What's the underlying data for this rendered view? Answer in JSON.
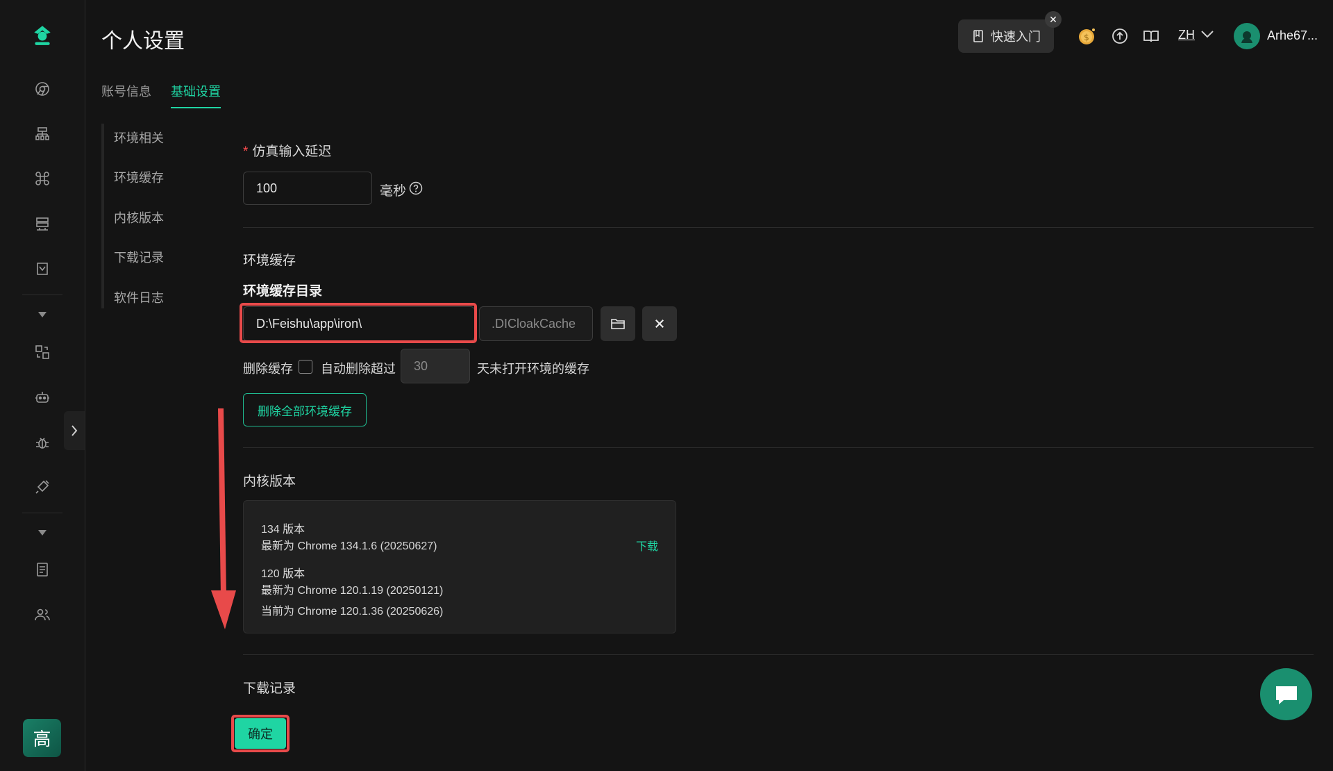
{
  "page": {
    "title": "个人设置"
  },
  "tabs": [
    {
      "label": "账号信息"
    },
    {
      "label": "基础设置"
    }
  ],
  "subnav": [
    "环境相关",
    "环境缓存",
    "内核版本",
    "下载记录",
    "软件日志"
  ],
  "topbar": {
    "quick_start": "快速入门",
    "lang": "ZH",
    "username": "Arhe67..."
  },
  "input_delay": {
    "label": "仿真输入延迟",
    "value": "100",
    "unit": "毫秒"
  },
  "cache": {
    "section_title": "环境缓存",
    "dir_label": "环境缓存目录",
    "dir_value": "D:\\Feishu\\app\\iron\\",
    "suffix": ".DICloakCache",
    "delete_label": "删除缓存",
    "auto_delete_label": "自动删除超过",
    "days_value": "30",
    "days_suffix": "天未打开环境的缓存",
    "delete_all_button": "删除全部环境缓存"
  },
  "kernel": {
    "section_title": "内核版本",
    "v134_title": "134 版本",
    "v134_latest": "最新为 Chrome 134.1.6 (20250627)",
    "download": "下载",
    "v120_title": "120 版本",
    "v120_latest": "最新为 Chrome 120.1.19 (20250121)",
    "v120_current": "当前为 Chrome 120.1.36 (20250626)"
  },
  "downloads": {
    "section_title": "下载记录"
  },
  "confirm_button": "确定",
  "user_badge": "高",
  "colors": {
    "accent": "#1fd5a3",
    "highlight": "#e84a4a",
    "background": "#141414"
  }
}
